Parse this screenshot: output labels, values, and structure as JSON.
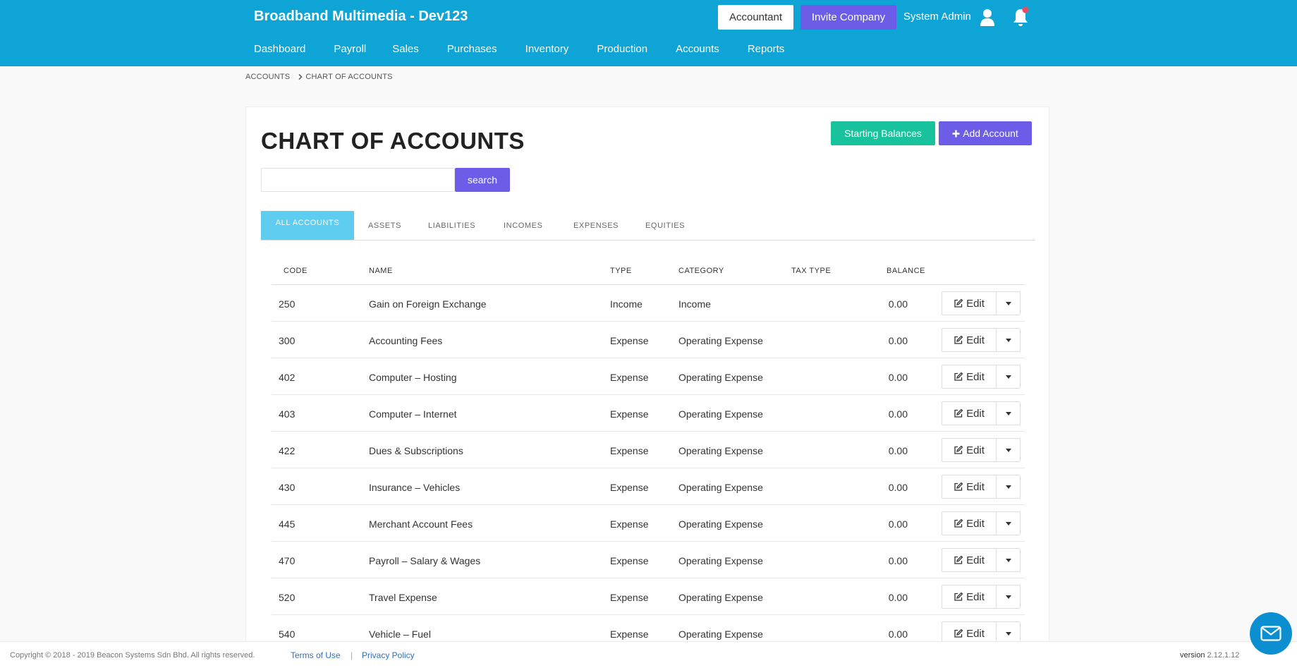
{
  "header": {
    "brand": "Broadband Multimedia - Dev123",
    "accountant_label": "Accountant",
    "invite_label": "Invite Company",
    "user_name": "System Admin"
  },
  "nav": [
    "Dashboard",
    "Payroll",
    "Sales",
    "Purchases",
    "Inventory",
    "Production",
    "Accounts",
    "Reports"
  ],
  "breadcrumb": [
    "ACCOUNTS",
    "CHART OF ACCOUNTS"
  ],
  "page": {
    "title": "CHART OF ACCOUNTS",
    "starting_balances_label": "Starting Balances",
    "add_account_label": "Add Account",
    "search_value": "",
    "search_button_label": "search"
  },
  "tabs": [
    "ALL ACCOUNTS",
    "ASSETS",
    "LIABILITIES",
    "INCOMES",
    "EXPENSES",
    "EQUITIES"
  ],
  "table": {
    "headers": [
      "CODE",
      "NAME",
      "TYPE",
      "CATEGORY",
      "TAX TYPE",
      "BALANCE"
    ],
    "edit_label": "Edit",
    "rows": [
      {
        "code": "250",
        "name": "Gain on Foreign Exchange",
        "type": "Income",
        "category": "Income",
        "tax_type": "",
        "balance": "0.00"
      },
      {
        "code": "300",
        "name": "Accounting Fees",
        "type": "Expense",
        "category": "Operating Expense",
        "tax_type": "",
        "balance": "0.00"
      },
      {
        "code": "402",
        "name": "Computer – Hosting",
        "type": "Expense",
        "category": "Operating Expense",
        "tax_type": "",
        "balance": "0.00"
      },
      {
        "code": "403",
        "name": "Computer – Internet",
        "type": "Expense",
        "category": "Operating Expense",
        "tax_type": "",
        "balance": "0.00"
      },
      {
        "code": "422",
        "name": "Dues & Subscriptions",
        "type": "Expense",
        "category": "Operating Expense",
        "tax_type": "",
        "balance": "0.00"
      },
      {
        "code": "430",
        "name": "Insurance – Vehicles",
        "type": "Expense",
        "category": "Operating Expense",
        "tax_type": "",
        "balance": "0.00"
      },
      {
        "code": "445",
        "name": "Merchant Account Fees",
        "type": "Expense",
        "category": "Operating Expense",
        "tax_type": "",
        "balance": "0.00"
      },
      {
        "code": "470",
        "name": "Payroll – Salary & Wages",
        "type": "Expense",
        "category": "Operating Expense",
        "tax_type": "",
        "balance": "0.00"
      },
      {
        "code": "520",
        "name": "Travel Expense",
        "type": "Expense",
        "category": "Operating Expense",
        "tax_type": "",
        "balance": "0.00"
      },
      {
        "code": "540",
        "name": "Vehicle – Fuel",
        "type": "Expense",
        "category": "Operating Expense",
        "tax_type": "",
        "balance": "0.00"
      }
    ]
  },
  "footer": {
    "copyright": "Copyright © 2018 - 2019 Beacon Systems Sdn Bhd. All rights reserved.",
    "terms_label": "Terms of Use",
    "separator": "|",
    "privacy_label": "Privacy Policy",
    "version_label": "version",
    "version_number": "2.12.1.12"
  },
  "colors": {
    "header_bg": "#0ea5d6",
    "primary_purple": "#6c5ce7",
    "teal": "#18c29c",
    "active_tab": "#5fcdf0",
    "notification_dot": "#e84a5f"
  },
  "icons": {
    "user": "user-icon",
    "notification": "bell-icon",
    "add": "plus-icon",
    "edit": "pencil-square-icon",
    "dropdown": "caret-down-icon",
    "chat": "envelope-icon"
  }
}
